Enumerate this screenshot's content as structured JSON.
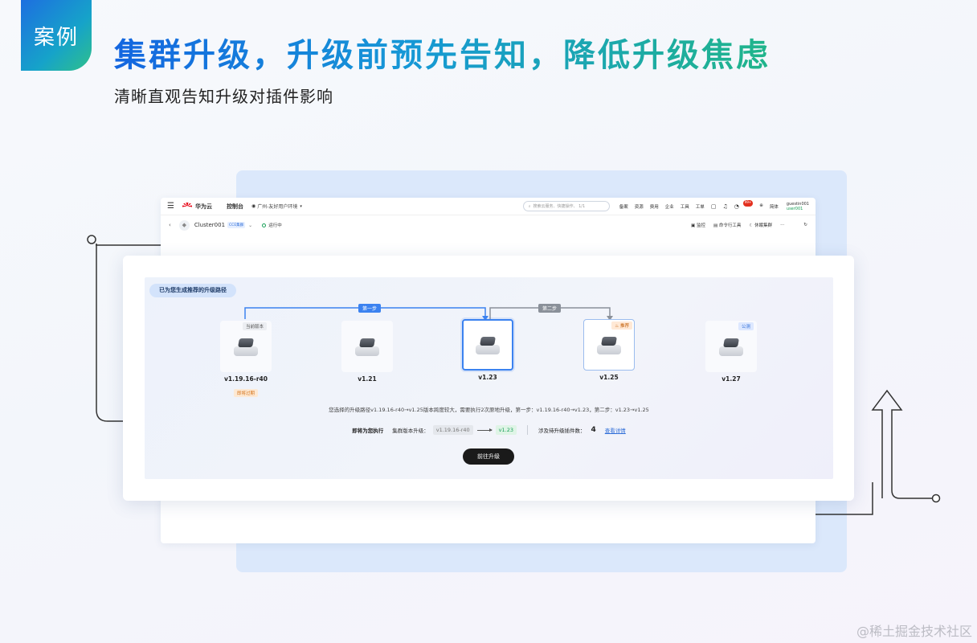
{
  "slide": {
    "badge": "案例",
    "title": "集群升级，升级前预先告知，降低升级焦虑",
    "subtitle": "清晰直观告知升级对插件影响",
    "watermark": "@稀土掘金技术社区"
  },
  "topbar": {
    "brand": "华为云",
    "console": "控制台",
    "region": "广州-友好用户环境",
    "search_placeholder": "搜索云服务、快捷操作、 1/1",
    "nav": [
      "备案",
      "资源",
      "费用",
      "企业",
      "工具",
      "工单"
    ],
    "notification_count": "99+",
    "language": "简体",
    "user_name": "guestin001",
    "user_sub": "user001"
  },
  "cluster": {
    "name": "Cluster001",
    "type_tag": "CCE集群",
    "status": "运行中",
    "actions": [
      "监控",
      "命令行工具",
      "休眠集群"
    ]
  },
  "upgrade": {
    "heading": "已为您生成推荐的升级路径",
    "step1": "第一步",
    "step2": "第二步",
    "versions": [
      {
        "label": "v1.19.16-r40",
        "tag": "当前版本",
        "sub_tag": "即将过期"
      },
      {
        "label": "v1.21"
      },
      {
        "label": "v1.23"
      },
      {
        "label": "v1.25",
        "tag": "推荐"
      },
      {
        "label": "v1.27",
        "tag": "公测"
      }
    ],
    "description": "您选择的升级路径v1.19.16-r40→v1.25版本跨度较大，需要执行2次原地升级，第一步：v1.19.16-r40→v1.23，第二步：v1.23→v1.25",
    "execute_label": "即将为您执行",
    "upgrade_key": "集群版本升级：",
    "from_version": "v1.19.16-r40",
    "to_version": "v1.23",
    "plugins_label": "涉及待升级插件数：",
    "plugin_count": "4",
    "detail_link": "查看详情",
    "button": "前往升级"
  },
  "colors": {
    "accent": "#3b82f0",
    "title_gradient_start": "#1466e0",
    "title_gradient_end": "#20b58a",
    "success": "#18a058"
  }
}
